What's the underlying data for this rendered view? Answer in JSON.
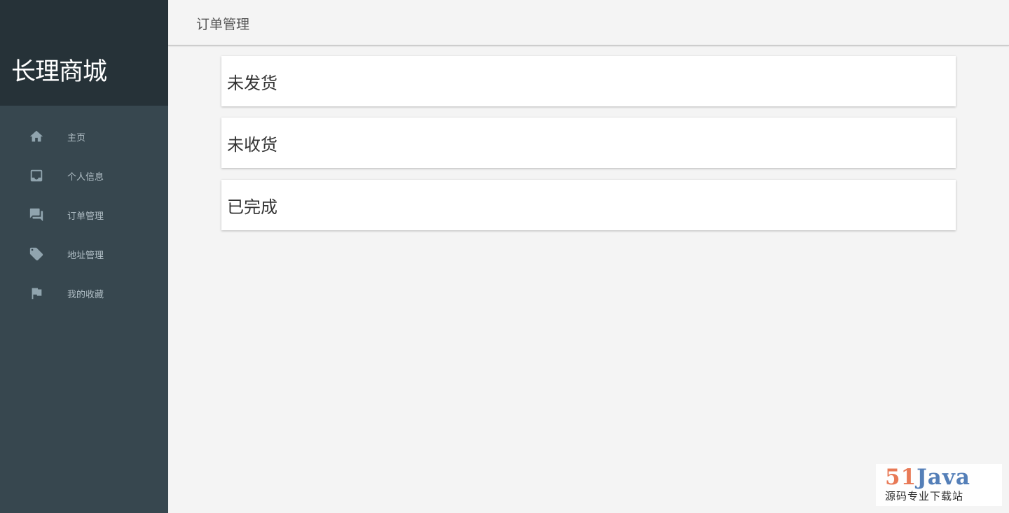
{
  "sidebar": {
    "brand": "长理商城",
    "items": [
      {
        "label": "主页",
        "icon": "home-icon"
      },
      {
        "label": "个人信息",
        "icon": "inbox-icon"
      },
      {
        "label": "订单管理",
        "icon": "forum-icon"
      },
      {
        "label": "地址管理",
        "icon": "tag-icon"
      },
      {
        "label": "我的收藏",
        "icon": "flag-icon"
      }
    ]
  },
  "header": {
    "title": "订单管理"
  },
  "main": {
    "cards": [
      {
        "label": "未发货"
      },
      {
        "label": "未收货"
      },
      {
        "label": "已完成"
      }
    ]
  },
  "watermark": {
    "logo_number": "51",
    "logo_word": "Java",
    "subtitle": "源码专业下载站"
  },
  "colors": {
    "sidebar_bg": "#37474f",
    "brand_bg": "#263238",
    "page_bg": "#f4f4f4",
    "card_bg": "#ffffff",
    "logo_orange": "#e8734e",
    "logo_blue": "#4c79b5"
  }
}
